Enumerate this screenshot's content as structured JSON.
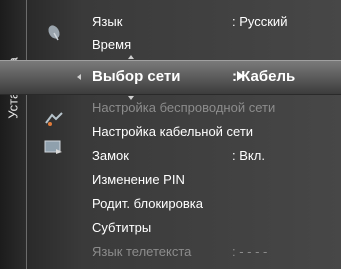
{
  "rail": {
    "label": "Установка"
  },
  "menu": {
    "items": [
      {
        "label": "Язык",
        "value": ": Русский",
        "state": "normal"
      },
      {
        "label": "Время",
        "value": "",
        "state": "normal"
      },
      {
        "label": "Выбор сети",
        "value": ": Кабель",
        "state": "selected"
      },
      {
        "label": "Настройка беспроводной сети",
        "value": "",
        "state": "disabled"
      },
      {
        "label": "Настройка кабельной сети",
        "value": "",
        "state": "normal"
      },
      {
        "label": "Замок",
        "value": ": Вкл.",
        "state": "normal"
      },
      {
        "label": "Изменение PIN",
        "value": "",
        "state": "normal"
      },
      {
        "label": "Родит. блокировка",
        "value": "",
        "state": "normal"
      },
      {
        "label": "Субтитры",
        "value": "",
        "state": "normal"
      },
      {
        "label": "Язык телетекста",
        "value": ": - - - -",
        "state": "disabled"
      }
    ]
  },
  "icons": [
    {
      "name": "satellite-dish-icon"
    },
    {
      "name": "gear-icon"
    },
    {
      "name": "signal-icon"
    },
    {
      "name": "input-source-icon"
    }
  ],
  "colors": {
    "text": "#ffffff",
    "disabled_text": "#8c8c8c",
    "panel": "#3a3a3a"
  }
}
